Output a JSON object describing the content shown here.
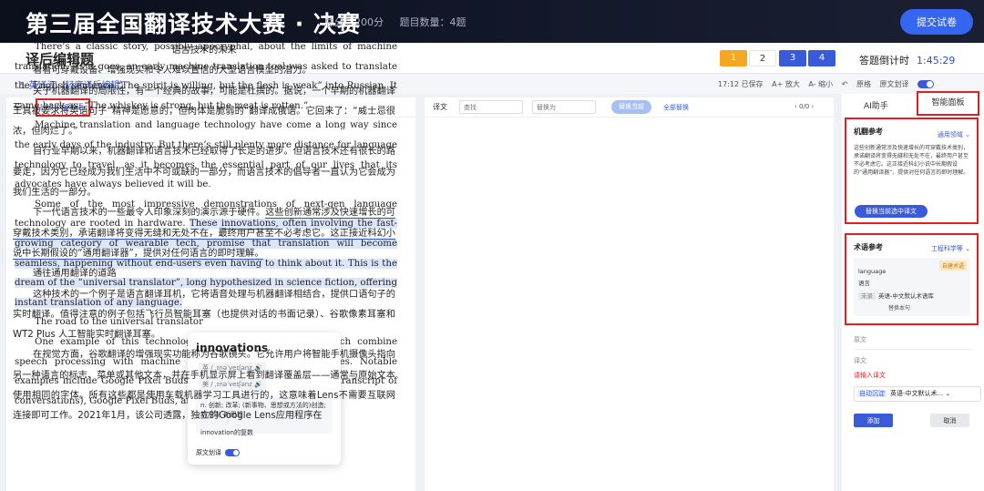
{
  "header": {
    "title": "第三届全国翻译技术大赛 · 决赛",
    "score": "总分：200分",
    "count": "题目数量：4题",
    "submit": "提交试卷"
  },
  "subheader": {
    "page_title": "译后编辑题",
    "questions": [
      "1",
      "2",
      "3",
      "4"
    ],
    "timer_label": "答题倒计时",
    "timer_value": "1:45:29"
  },
  "toolbar": {
    "question_label": "1.英译汉（轻度译后编辑）",
    "saved": "17:12 已保存",
    "zoom_in": "A+ 放大",
    "zoom_out": "A- 缩小",
    "undo": "↶",
    "original_layout": "原格",
    "source_split": "原文划译"
  },
  "left": {
    "menu_icon": "☰",
    "add_term": "[+] 添加术语",
    "paragraphs": [
      "There’s a classic story, possibly apocryphal, about the limits of machine translation. As it goes, an early machine translation tool was asked to translate the English sentence “The spirit is willing, but the flesh is weak” into Russian. It came back as: “The whiskey is strong, but the meat is rotten.”",
      "Machine translation and language technology have come a long way since the early days of the industry. But there’s still plenty more distance for language technology to travel, as it becomes the essential part of our lives that its advocates have always believed it will be.",
      "The road to the universal translator",
      "One example of this technology is translation earbuds, which combine speech processing with machine translation of spoken sentences. Notable examples include Google Pixel Buds (which also provide a written transcript of conversations), Google Pixel Buds, and WT2 Plus AI Real-time"
    ],
    "para3_before": "Some of the most impressive demonstrations of next-gen language technology are rooted in hardware. ",
    "para3_hl_a": "These ",
    "para3_word": "innovations",
    "para3_hl_b": ", often involving the fast-growing category of wearable tech, promise that translation will become seamless, happening without end-users even having to think about it. This is the dream of the “universal translator”, long hypothesized in science fiction, offering instant translation of any language."
  },
  "popup": {
    "word": "innovations",
    "ph_uk": "英 / ˌɪnəˈveɪʃənz 🔊",
    "ph_us": "美 / ˌɪnəˈveɪʃənz 🔊",
    "def": "n. 创新; 改革; (新事物、思想或方法的)创造; 新方法; 新思想",
    "plural": "innovation的复数",
    "source_split": "原文划译"
  },
  "middle": {
    "label": "译文",
    "find_placeholder": "查找",
    "replace_placeholder": "替换为",
    "replace_current": "替换当前",
    "replace_all": "全部替换",
    "count": "‹ 0/0 ›",
    "title": "语言技术的未来",
    "p1": "看看可穿戴设备、增强现实和令人难以置信的大型语言模型的潜力。",
    "p2": "关于机器翻译的局限性，有一个经典的故事，可能是杜撰的。据说，一个早期的机器翻译工具被要求将英语句子“精神是愿意的，但肉体是脆弱的”翻译成俄语。它回来了：“威士忌很浓，但肉烂了。”",
    "p3": "自行业早期以来，机器翻译和语言技术已经取得了长足的进步。但语言技术还有很长的路要走，因为它已经成为我们生活中不可或缺的一部分，而语言技术的倡导者一直认为它会成为我们生活的一部分。",
    "p4_before": "下一代语言技术的一些最令人印象深刻的演示源于硬件。",
    "p4_ul": "这些创新通常涉及快速增长的可穿戴技术类别，承诺翻译将变得无缝和无处不在，最终用户甚至不必考虑它。这正接近科幻小说中长期假设的“通用翻译器”，提供对任何语言的即时理解。",
    "p5": "通往通用翻译的道路",
    "p6": "这种技术的一个例子是语言翻译耳机，它将语音处理与机器翻译相结合，提供口语句子的实时翻译。值得注意的例子包括飞行员智能耳塞（也提供对话的书面记录）、谷歌像素耳塞和WT2 Plus 人工智能实时翻译耳塞。",
    "p7": "在视觉方面，谷歌翻译的增强现实功能称为谷歌镜头。它允许用户将智能手机摄像头指向另一种语言的标志、菜单或其他文本，并在手机显示屏上看到翻译覆盖层——通常与原始文本使用相同的字体。所有这些都是使用车载机器学习工具进行的，这意味着Lens不需要互联网连接即可工作。2021年1月，该公司透露，独立的Google Lens应用程序在"
  },
  "right": {
    "tab_ai": "AI助手",
    "tab_smart": "智能面板",
    "mt_title": "机翻参考",
    "mt_domain": "通用领域 ⌄",
    "mt_text": "这些创新通常涉及快速增长的可穿戴技术类别，承诺翻译将变得无缝和无处不在，最终用户甚至不必考虑它。这正接近科幻小说中长期假设的“通用翻译器”，提供对任何语言的即时理解。",
    "mt_btn": "替换当前选中译文",
    "term_title": "术语参考",
    "term_domain": "工程科学等 ⌄",
    "term_tag": "自建术语",
    "term_src": "language",
    "term_tgt": "语言",
    "term_lang_tag": "未录",
    "term_lang": "英语-中文默认术语库",
    "term_replace": "替换本句",
    "src_label": "原文",
    "tgt_label": "译文",
    "tgt_hint": "请输入译文",
    "auto_tag": "自动沉淀",
    "auto_lang": "英语-中文默认术...  ⌄",
    "add": "添加",
    "cancel": "取消"
  }
}
